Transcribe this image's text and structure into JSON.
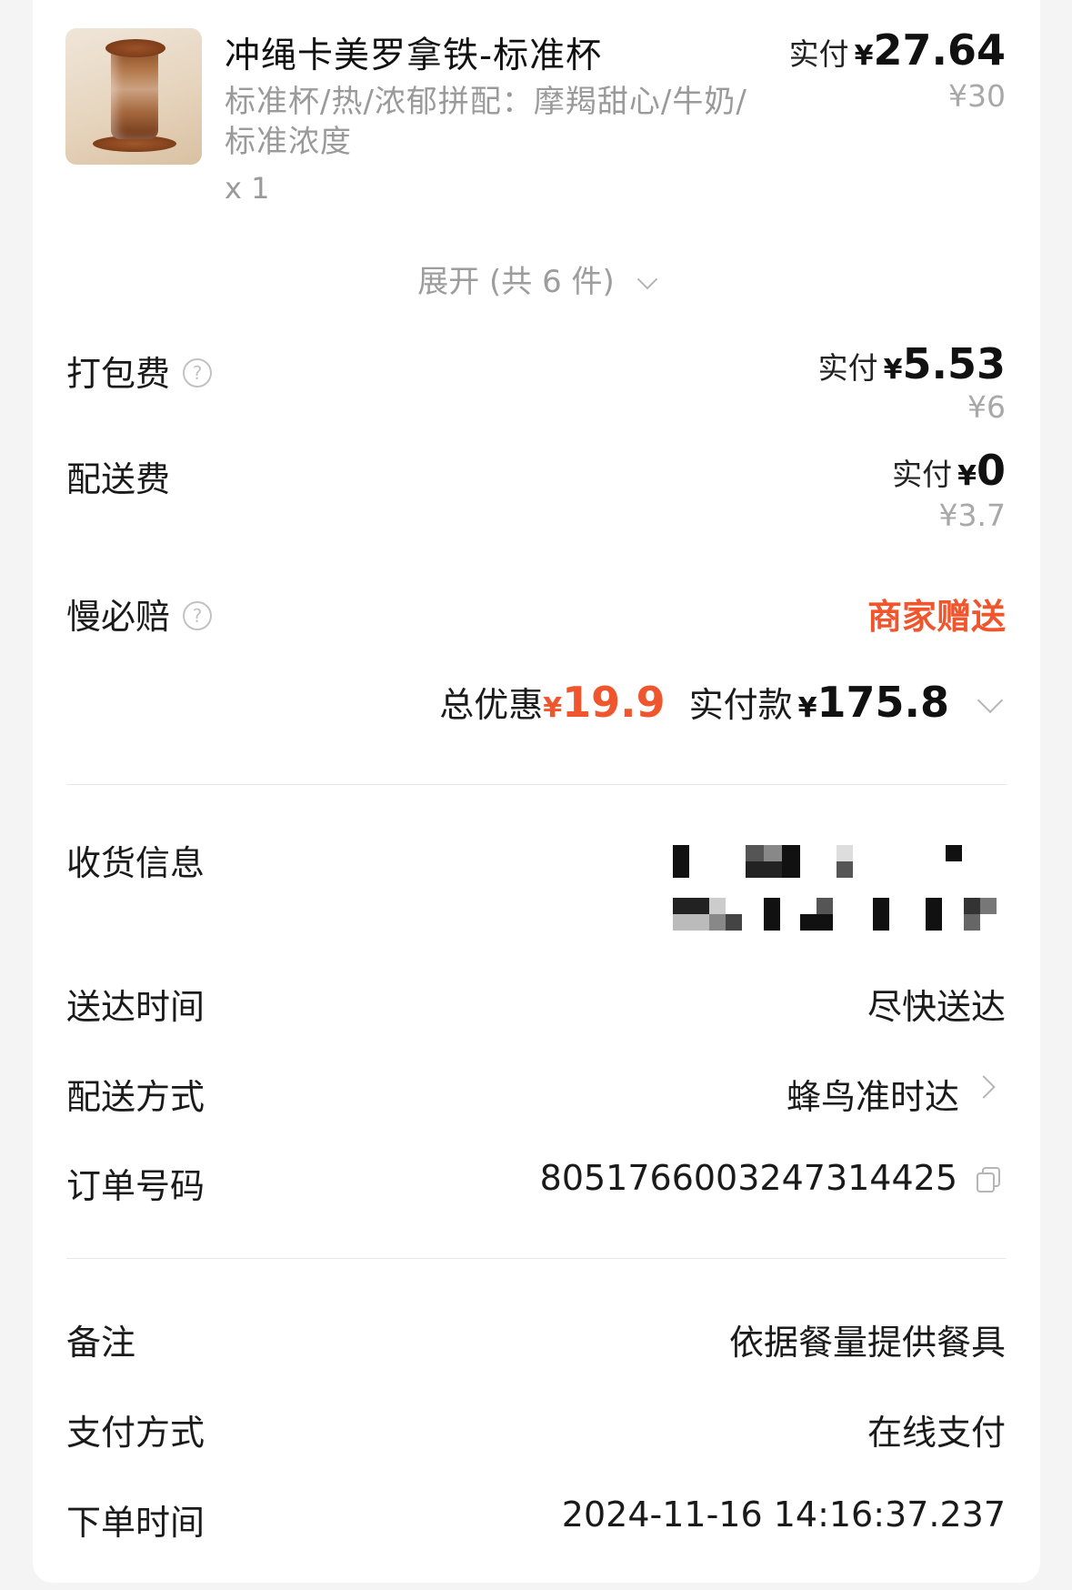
{
  "product": {
    "name": "冲绳卡美罗拿铁-标准杯",
    "spec": "标准杯/热/浓郁拼配：摩羯甜心/牛奶/标准浓度",
    "quantity": "x 1",
    "paid_label": "实付",
    "currency": "¥",
    "paid_amount": "27.64",
    "original_price": "¥30"
  },
  "expand": {
    "label": "展开 (共 6 件)"
  },
  "fees": {
    "packing": {
      "label": "打包费",
      "help_icon": "question-circle-icon",
      "paid_label": "实付",
      "currency": "¥",
      "paid_amount": "5.53",
      "original_price": "¥6"
    },
    "delivery": {
      "label": "配送费",
      "paid_label": "实付",
      "currency": "¥",
      "paid_amount": "0",
      "original_price": "¥3.7"
    },
    "slow_compensation": {
      "label": "慢必赔",
      "help_icon": "question-circle-icon",
      "value": "商家赠送",
      "value_color": "#f0562e"
    }
  },
  "summary": {
    "discount_label": "总优惠",
    "currency": "¥",
    "discount_amount": "19.9",
    "total_label": "实付款",
    "total_amount": "175.8",
    "accent_color": "#f0562e"
  },
  "order_info": {
    "receiver": {
      "label": "收货信息"
    },
    "delivery_time": {
      "label": "送达时间",
      "value": "尽快送达"
    },
    "delivery_method": {
      "label": "配送方式",
      "value": "蜂鸟准时达"
    },
    "order_number": {
      "label": "订单号码",
      "value": "8051766003247314425",
      "copy_icon": "copy-icon"
    },
    "remark": {
      "label": "备注",
      "value": "依据餐量提供餐具"
    },
    "payment_method": {
      "label": "支付方式",
      "value": "在线支付"
    },
    "order_time": {
      "label": "下单时间",
      "value": "2024-11-16 14:16:37.237"
    }
  }
}
